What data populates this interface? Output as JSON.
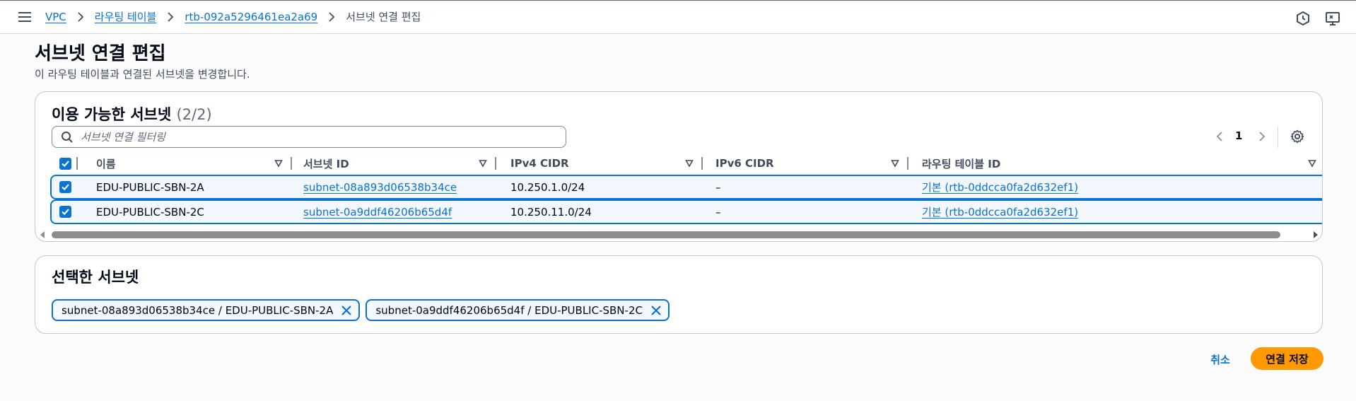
{
  "colors": {
    "accent": "#0972d3",
    "primary_button": "#ff9900",
    "selected_row_bg": "#f2f8fd",
    "text": "#000716",
    "secondary_text": "#414d5c"
  },
  "topbar": {
    "menu_icon": "hamburger-menu-icon",
    "breadcrumbs": [
      {
        "label": "VPC"
      },
      {
        "label": "라우팅 테이블"
      },
      {
        "label": "rtb-092a5296461ea2a69"
      },
      {
        "label": "서브넷 연결 편집"
      }
    ],
    "right_icons": [
      "notification-hexagon-icon",
      "display-feedback-icon"
    ]
  },
  "page": {
    "title": "서브넷 연결 편집",
    "description": "이 라우팅 테이블과 연결된 서브넷을 변경합니다."
  },
  "available": {
    "title": "이용 가능한 서브넷",
    "count": "(2/2)",
    "filter_placeholder": "서브넷 연결 필터링",
    "filter_value": "",
    "page_number": "1",
    "columns": [
      "이름",
      "서브넷 ID",
      "IPv4 CIDR",
      "IPv6 CIDR",
      "라우팅 테이블 ID"
    ],
    "rows": [
      {
        "name": "EDU-PUBLIC-SBN-2A",
        "subnet_id": "subnet-08a893d06538b34ce",
        "ipv4": "10.250.1.0/24",
        "ipv6": "–",
        "rtb": "기본 (rtb-0ddcca0fa2d632ef1)",
        "checked": true
      },
      {
        "name": "EDU-PUBLIC-SBN-2C",
        "subnet_id": "subnet-0a9ddf46206b65d4f",
        "ipv4": "10.250.11.0/24",
        "ipv6": "–",
        "rtb": "기본 (rtb-0ddcca0fa2d632ef1)",
        "checked": true
      }
    ]
  },
  "selected": {
    "title": "선택한 서브넷",
    "tokens": [
      {
        "label": "subnet-08a893d06538b34ce / EDU-PUBLIC-SBN-2A"
      },
      {
        "label": "subnet-0a9ddf46206b65d4f / EDU-PUBLIC-SBN-2C"
      }
    ]
  },
  "actions": {
    "cancel": "취소",
    "save": "연결 저장"
  }
}
